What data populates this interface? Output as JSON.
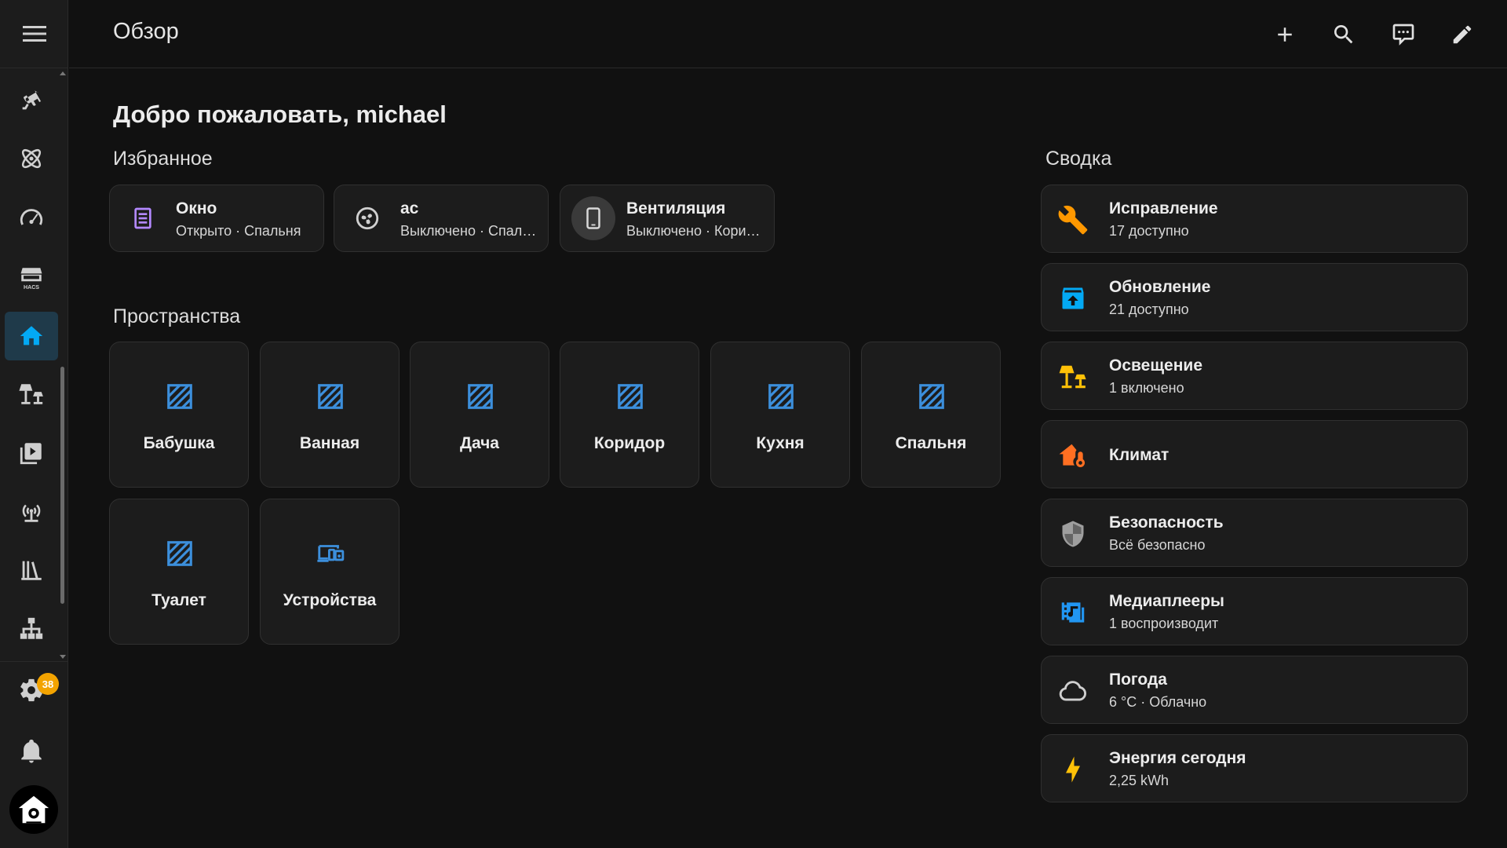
{
  "header": {
    "title": "Обзор",
    "actions": [
      "plus-icon",
      "search-icon",
      "assist-icon",
      "pencil-icon"
    ]
  },
  "sidebar": {
    "items": [
      {
        "name": "cctv-icon"
      },
      {
        "name": "atom-icon"
      },
      {
        "name": "gauge-icon"
      },
      {
        "name": "hacs-icon",
        "label": "HACS"
      },
      {
        "name": "home-icon",
        "active": true
      },
      {
        "name": "lamps-icon"
      },
      {
        "name": "media-icon"
      },
      {
        "name": "antenna-icon"
      },
      {
        "name": "library-icon"
      },
      {
        "name": "sitemap-icon"
      }
    ],
    "settings_badge": "38",
    "accent_color": "#03a9f4"
  },
  "welcome": "Добро пожаловать, michael",
  "favorites": {
    "title": "Избранное",
    "items": [
      {
        "name": "Окно",
        "sub": "Открыто · Спальня",
        "icon": "window-icon"
      },
      {
        "name": "ac",
        "sub": "Выключено · Спальня",
        "icon": "fan-icon"
      },
      {
        "name": "Вентиляция",
        "sub": "Выключено · Коридор",
        "icon": "phone-icon"
      }
    ]
  },
  "areas": {
    "title": "Пространства",
    "items": [
      {
        "label": "Бабушка",
        "icon": "area-icon"
      },
      {
        "label": "Ванная",
        "icon": "area-icon"
      },
      {
        "label": "Дача",
        "icon": "area-icon"
      },
      {
        "label": "Коридор",
        "icon": "area-icon"
      },
      {
        "label": "Кухня",
        "icon": "area-icon"
      },
      {
        "label": "Спальня",
        "icon": "area-icon"
      },
      {
        "label": "Туалет",
        "icon": "area-icon"
      },
      {
        "label": "Устройства",
        "icon": "devices-icon"
      }
    ]
  },
  "summary": {
    "title": "Сводка",
    "items": [
      {
        "name": "Исправление",
        "sub": "17 доступно",
        "icon": "wrench-icon",
        "color": "#ff9800"
      },
      {
        "name": "Обновление",
        "sub": "21 доступно",
        "icon": "package-up-icon",
        "color": "#03a9f4"
      },
      {
        "name": "Освещение",
        "sub": "1 включено",
        "icon": "lamps-icon",
        "color": "#ffc107"
      },
      {
        "name": "Климат",
        "sub": "",
        "icon": "home-thermometer-icon",
        "color": "#ff6f22"
      },
      {
        "name": "Безопасность",
        "sub": "Всё безопасно",
        "icon": "shield-icon",
        "color": "#9e9e9e"
      },
      {
        "name": "Медиаплееры",
        "sub": "1 воспроизводит",
        "icon": "multimedia-icon",
        "color": "#2196f3"
      },
      {
        "name": "Погода",
        "sub": "6 °C · Облачно",
        "icon": "cloud-icon",
        "color": "#cfcfcf"
      },
      {
        "name": "Энергия сегодня",
        "sub": "2,25 kWh",
        "icon": "lightning-icon",
        "color": "#ffc107"
      }
    ]
  }
}
